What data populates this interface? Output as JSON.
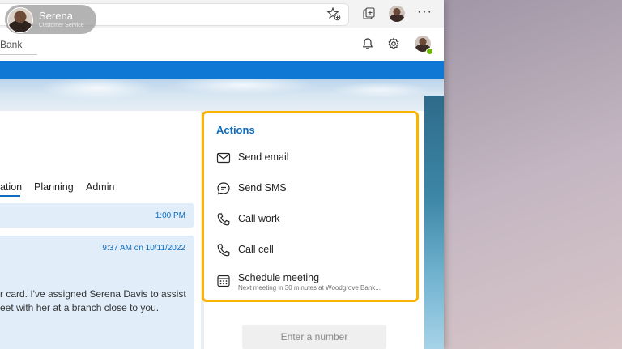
{
  "presenter": {
    "name": "Serena",
    "role": "Customer Service"
  },
  "app": {
    "title": "Bank"
  },
  "tabs": [
    {
      "label": "ation"
    },
    {
      "label": "Planning"
    },
    {
      "label": "Admin"
    }
  ],
  "messages": [
    {
      "time": "1:00 PM"
    },
    {
      "time": "9:37 AM on 10/11/2022",
      "line1": "r card. I've assigned Serena Davis to assist",
      "line2": "eet with her at a branch close to you."
    }
  ],
  "actions": {
    "title": "Actions",
    "items": [
      {
        "label": "Send email",
        "icon": "mail-icon"
      },
      {
        "label": "Send SMS",
        "icon": "chat-icon"
      },
      {
        "label": "Call work",
        "icon": "phone-icon"
      },
      {
        "label": "Call cell",
        "icon": "phone-icon"
      },
      {
        "label": "Schedule meeting",
        "icon": "calendar-icon",
        "sublabel": "Next meeting in 30 minutes at Woodgrove Bank..."
      }
    ]
  },
  "number_input": {
    "placeholder": "Enter a number"
  },
  "colors": {
    "accent": "#0f6cbd",
    "highlight": "#f8b400",
    "banner": "#0f78d4"
  }
}
